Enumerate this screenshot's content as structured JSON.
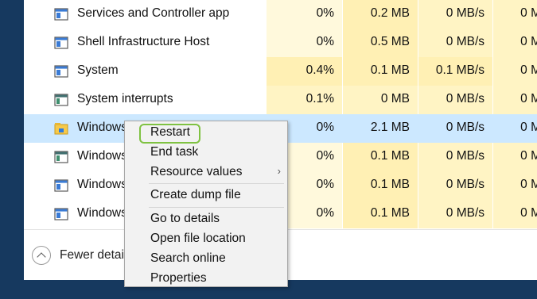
{
  "processes": [
    {
      "name": "Services and Controller app",
      "icon": "app-window-icon",
      "cpu": "0%",
      "memory": "0.2 MB",
      "disk": "0 MB/s",
      "network": "0 M",
      "cpu_bg": "#fff9dc",
      "mem_bg": "#fff0b4",
      "disk_bg": "#fff4c4",
      "net_bg": "#fff4c4"
    },
    {
      "name": "Shell Infrastructure Host",
      "icon": "app-window-icon",
      "cpu": "0%",
      "memory": "0.5 MB",
      "disk": "0 MB/s",
      "network": "0 M",
      "cpu_bg": "#fff9dc",
      "mem_bg": "#fff0b4",
      "disk_bg": "#fff4c4",
      "net_bg": "#fff4c4"
    },
    {
      "name": "System",
      "icon": "app-window-icon",
      "cpu": "0.4%",
      "memory": "0.1 MB",
      "disk": "0.1 MB/s",
      "network": "0 M",
      "cpu_bg": "#fff0b4",
      "mem_bg": "#fff0b4",
      "disk_bg": "#fff0b4",
      "net_bg": "#fff4c4"
    },
    {
      "name": "System interrupts",
      "icon": "system-window-icon",
      "cpu": "0.1%",
      "memory": "0 MB",
      "disk": "0 MB/s",
      "network": "0 M",
      "cpu_bg": "#fff4c4",
      "mem_bg": "#fff4c4",
      "disk_bg": "#fff4c4",
      "net_bg": "#fff4c4"
    },
    {
      "name": "Windows",
      "icon": "folder-explorer-icon",
      "cpu": "0%",
      "memory": "2.1 MB",
      "disk": "0 MB/s",
      "network": "0 M",
      "selected": true
    },
    {
      "name": "Windows",
      "icon": "system-window-icon",
      "cpu": "0%",
      "memory": "0.1 MB",
      "disk": "0 MB/s",
      "network": "0 M",
      "cpu_bg": "#fff9dc",
      "mem_bg": "#fff0b4",
      "disk_bg": "#fff4c4",
      "net_bg": "#fff4c4"
    },
    {
      "name": "Windows",
      "icon": "app-window-icon",
      "cpu": "0%",
      "memory": "0.1 MB",
      "disk": "0 MB/s",
      "network": "0 M",
      "cpu_bg": "#fff9dc",
      "mem_bg": "#fff0b4",
      "disk_bg": "#fff4c4",
      "net_bg": "#fff4c4"
    },
    {
      "name": "Windows",
      "icon": "app-window-icon",
      "cpu": "0%",
      "memory": "0.1 MB",
      "disk": "0 MB/s",
      "network": "0 M",
      "cpu_bg": "#fff9dc",
      "mem_bg": "#fff0b4",
      "disk_bg": "#fff4c4",
      "net_bg": "#fff4c4"
    }
  ],
  "footer": {
    "fewer_details_label": "Fewer detai"
  },
  "context_menu": {
    "items": [
      {
        "label": "Restart",
        "highlighted": true
      },
      {
        "label": "End task"
      },
      {
        "label": "Resource values",
        "submenu": true
      },
      {
        "separator": true
      },
      {
        "label": "Create dump file"
      },
      {
        "separator": true
      },
      {
        "label": "Go to details"
      },
      {
        "label": "Open file location"
      },
      {
        "label": "Search online"
      },
      {
        "label": "Properties"
      }
    ],
    "submenu_arrow": "›"
  },
  "colors": {
    "desktop_bg": "#16395f",
    "selected_row": "#cce8ff",
    "highlight_frame": "#7fc242",
    "menu_bg": "#f2f2f2"
  }
}
